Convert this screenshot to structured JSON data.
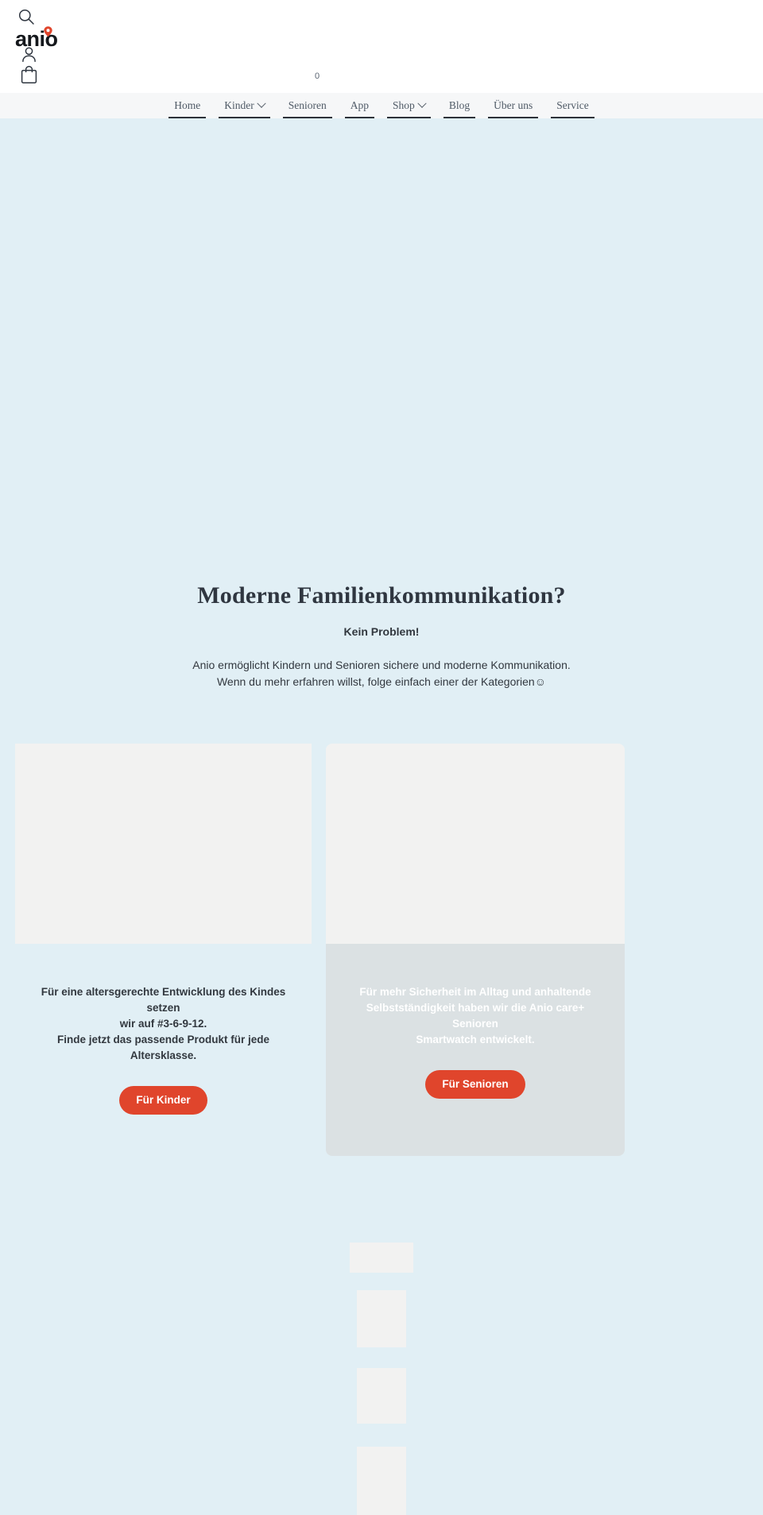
{
  "header": {
    "logo_text": "anio",
    "search_icon": "search-icon",
    "account_icon": "user-icon",
    "cart_icon": "shopping-bag-icon",
    "cart_count": "0"
  },
  "nav": {
    "items": [
      {
        "label": "Home",
        "has_dropdown": false
      },
      {
        "label": "Kinder",
        "has_dropdown": true
      },
      {
        "label": "Senioren",
        "has_dropdown": false
      },
      {
        "label": "App",
        "has_dropdown": false
      },
      {
        "label": "Shop",
        "has_dropdown": true
      },
      {
        "label": "Blog",
        "has_dropdown": false
      },
      {
        "label": "Über uns",
        "has_dropdown": false
      },
      {
        "label": "Service",
        "has_dropdown": false
      }
    ]
  },
  "hero": {
    "title": "Moderne Familienkommunikation?",
    "subtitle": "Kein Problem!",
    "line1": "Anio ermöglicht Kindern und Senioren sichere und moderne Kommunikation.",
    "line2": "Wenn du mehr erfahren willst, folge einfach einer der Kategorien☺"
  },
  "cards": [
    {
      "id": "kinder",
      "line1": "Für eine altersgerechte Entwicklung des Kindes setzen",
      "line2": "wir auf #3-6-9-12.",
      "line3": "Finde jetzt das passende Produkt für jede Altersklasse.",
      "button_label": "Für Kinder"
    },
    {
      "id": "senioren",
      "line1": "Für mehr Sicherheit im Alltag und anhaltende",
      "line2": "Selbstständigkeit haben wir die Anio care+ Senioren",
      "line3": "Smartwatch entwickelt.",
      "button_label": "Für Senioren"
    }
  ],
  "colors": {
    "page_background": "#e1eff5",
    "header_background": "#ffffff",
    "nav_background": "#f6f7f8",
    "accent_red": "#e0452c",
    "logo_pin_red": "#e0452c",
    "placeholder_gray": "#f2f2f1",
    "senior_card_gray": "#dbe1e3",
    "text_dark": "#32383f"
  }
}
